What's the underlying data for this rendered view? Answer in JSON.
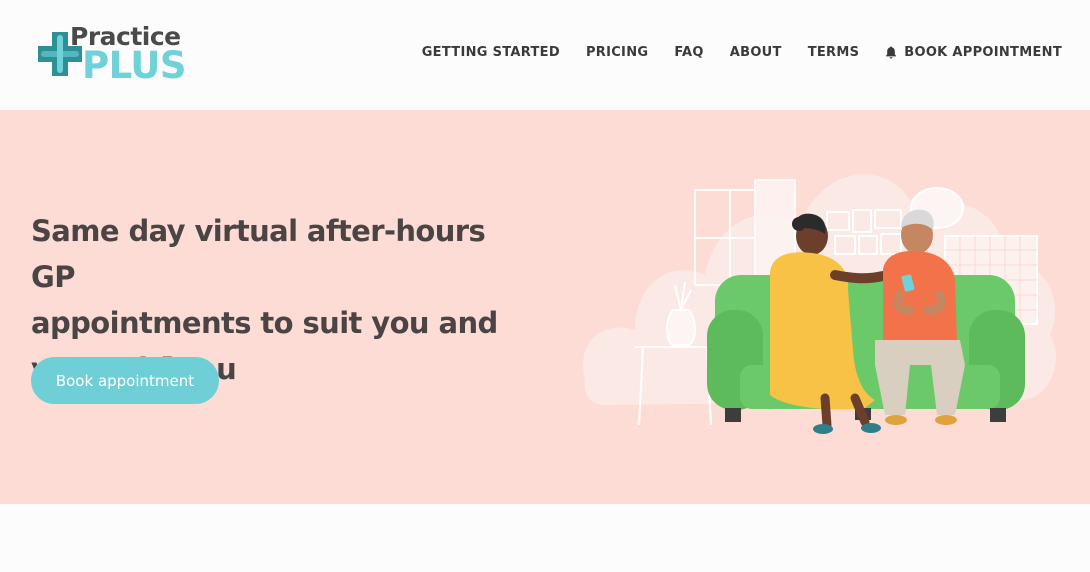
{
  "header": {
    "logo": {
      "line1": "Practice",
      "line2": "PLUS"
    },
    "nav": [
      {
        "label": "GETTING STARTED"
      },
      {
        "label": "PRICING"
      },
      {
        "label": "FAQ"
      },
      {
        "label": "ABOUT"
      },
      {
        "label": "TERMS"
      },
      {
        "label": "BOOK APPOINTMENT",
        "icon": "bell-icon"
      }
    ]
  },
  "hero": {
    "headline_lines": [
      "Same day virtual after-hours GP",
      "appointments to suit you and",
      "your whānau"
    ],
    "cta_label": "Book appointment"
  },
  "colors": {
    "brand_teal": "#6fd2d9",
    "hero_bg": "#fddcd6",
    "text_dark": "#4a4444",
    "sofa_green": "#6cc96a"
  }
}
